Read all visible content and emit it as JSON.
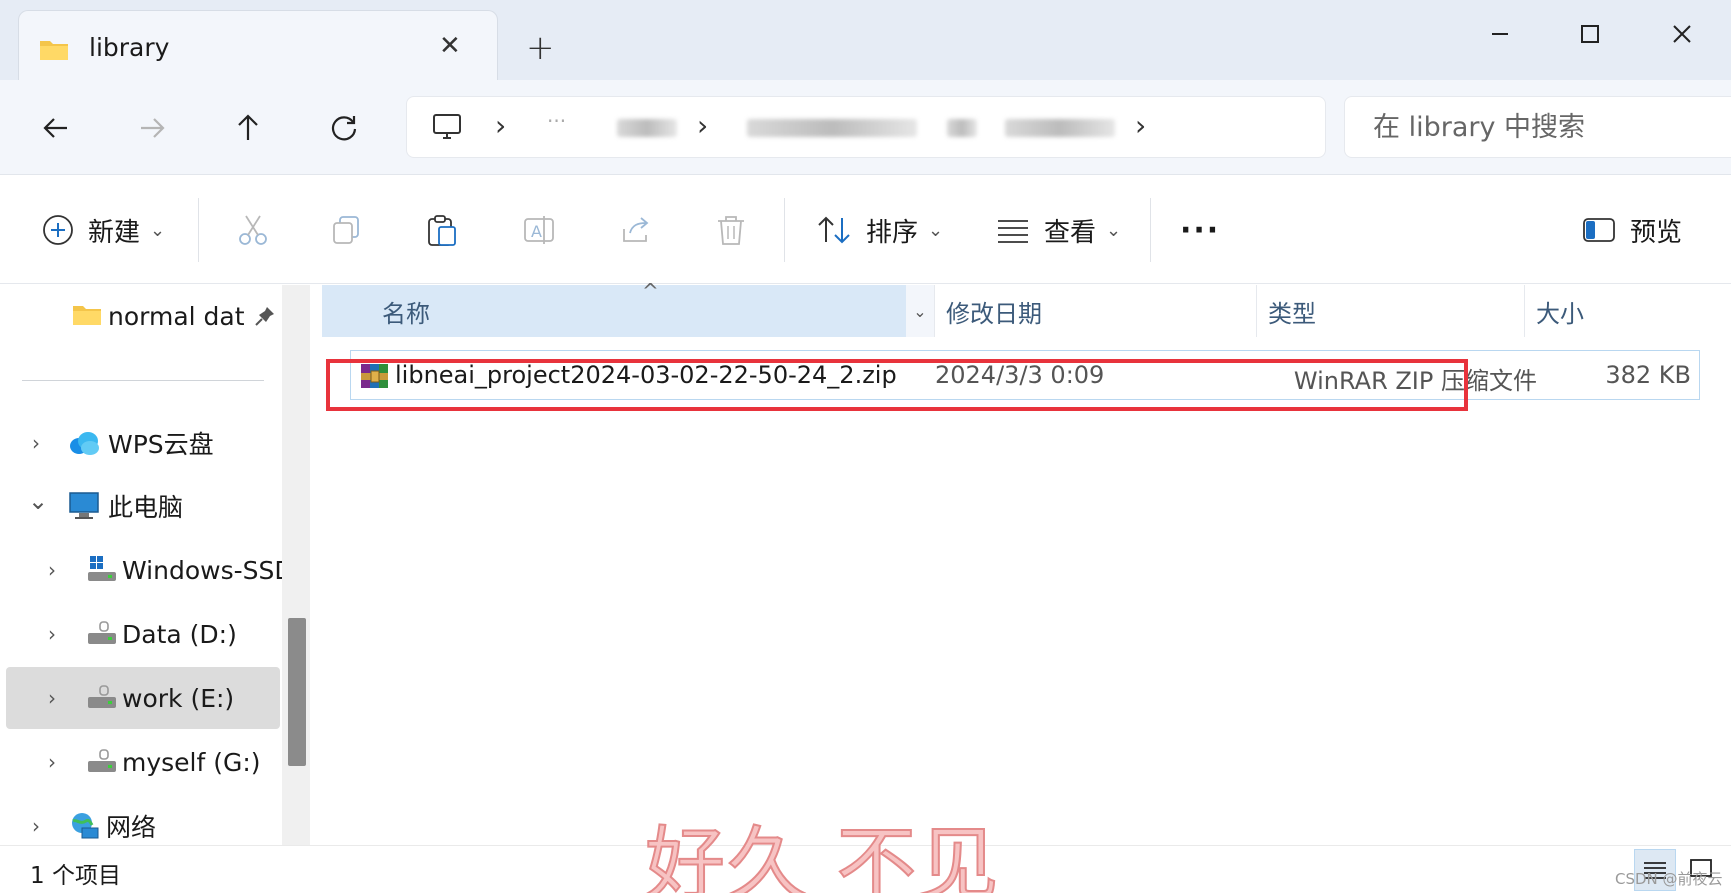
{
  "window": {
    "tab_title": "library",
    "tab_close": "✕",
    "new_tab": "+"
  },
  "navigation": {
    "back_icon": "arrow-left-icon",
    "forward_icon": "arrow-right-icon",
    "up_icon": "arrow-up-icon",
    "refresh_icon": "refresh-icon"
  },
  "address": {
    "separator": "›",
    "ellipsis": "···"
  },
  "search": {
    "placeholder": "在 library 中搜索"
  },
  "commandbar": {
    "new_label": "新建",
    "sort_label": "排序",
    "view_label": "查看",
    "more_label": "···",
    "preview_label": "预览",
    "chevron": "⌄"
  },
  "sidebar": {
    "items": [
      {
        "label": "normal dat",
        "icon": "folder-icon",
        "pinned": true
      },
      {
        "label": "WPS云盘",
        "icon": "cloud-icon"
      },
      {
        "label": "此电脑",
        "icon": "computer-icon",
        "expanded": true
      },
      {
        "label": "Windows-SSD",
        "icon": "drive-icon"
      },
      {
        "label": "Data (D:)",
        "icon": "drive-icon"
      },
      {
        "label": "work (E:)",
        "icon": "drive-icon",
        "selected": true
      },
      {
        "label": "myself (G:)",
        "icon": "drive-icon"
      },
      {
        "label": "网络",
        "icon": "network-icon"
      }
    ],
    "chevron_right": "›",
    "chevron_down": "⌄"
  },
  "filelist": {
    "columns": [
      "名称",
      "修改日期",
      "类型",
      "大小"
    ],
    "sort_indicator": "^",
    "files": [
      {
        "name": "libneai_project2024-03-02-22-50-24_2.zip",
        "modified": "2024/3/3 0:09",
        "type": "WinRAR ZIP 压缩文件",
        "size": "382 KB",
        "icon": "winrar-archive-icon"
      }
    ]
  },
  "status": {
    "item_count": "1 个项目"
  },
  "overlay": {
    "text": "好久 不见",
    "watermark": "CSDN @前夜云"
  },
  "colors": {
    "highlight": "#e8333c",
    "selection_border": "#b9d7f0",
    "header_sorted": "#d9e8f7"
  }
}
